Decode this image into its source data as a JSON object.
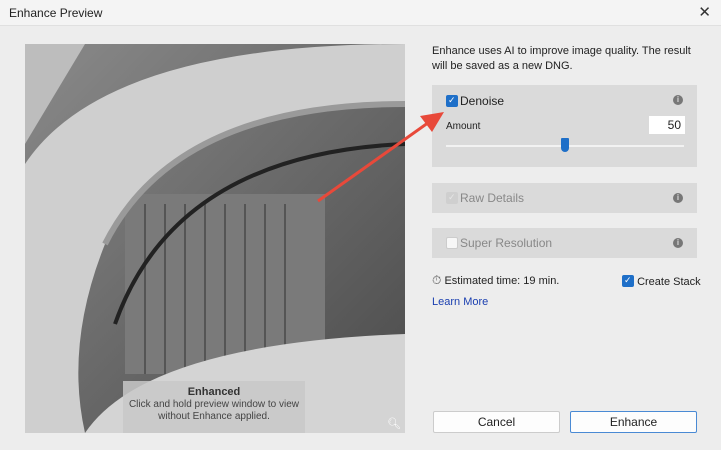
{
  "window": {
    "title": "Enhance Preview",
    "close_icon": "close-icon"
  },
  "preview": {
    "overlay_title": "Enhanced",
    "overlay_text": "Click and hold preview window to view without Enhance applied.",
    "zoom_icon": "zoom-icon"
  },
  "description": "Enhance uses AI to improve image quality. The result will be saved as a new DNG.",
  "denoise": {
    "label": "Denoise",
    "checked": true,
    "amount_label": "Amount",
    "amount_value": "50",
    "slider_percent": 50
  },
  "raw_details": {
    "label": "Raw Details",
    "checked": true,
    "disabled": true
  },
  "super_resolution": {
    "label": "Super Resolution",
    "checked": false
  },
  "estimate": "Estimated time: 19 min.",
  "create_stack": {
    "label": "Create Stack",
    "checked": true
  },
  "learn_more": "Learn More",
  "buttons": {
    "cancel": "Cancel",
    "enhance": "Enhance"
  },
  "colors": {
    "accent": "#1e6fc8",
    "annotation_arrow": "#e8493a"
  }
}
